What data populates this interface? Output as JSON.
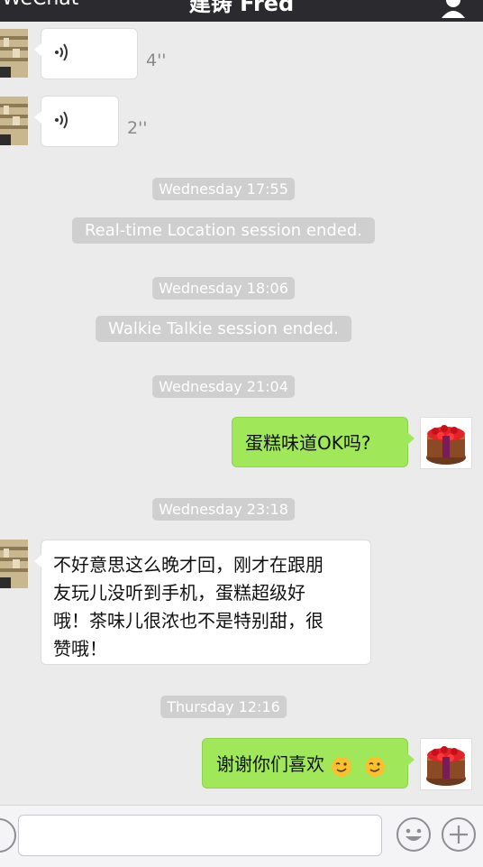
{
  "header": {
    "back_label": "WeChat",
    "title": "建铸 Fred"
  },
  "messages": [
    {
      "kind": "voice",
      "side": "left",
      "duration": "4''"
    },
    {
      "kind": "voice",
      "side": "left",
      "duration": "2''"
    },
    {
      "kind": "time",
      "text": "Wednesday 17:55"
    },
    {
      "kind": "system",
      "text": "Real-time Location session ended."
    },
    {
      "kind": "time",
      "text": "Wednesday 18:06"
    },
    {
      "kind": "system",
      "text": "Walkie Talkie session ended."
    },
    {
      "kind": "time",
      "text": "Wednesday 21:04"
    },
    {
      "kind": "text",
      "side": "right",
      "lines": [
        "蛋糕味道OK吗?"
      ]
    },
    {
      "kind": "time",
      "text": "Wednesday 23:18"
    },
    {
      "kind": "text",
      "side": "left",
      "lines": [
        "不好意思这么晚才回，刚才在跟朋",
        "友玩儿没听到手机，蛋糕超级好",
        "哦！茶味儿很浓也不是特别甜，很",
        "赞哦！"
      ]
    },
    {
      "kind": "time",
      "text": "Thursday 12:16"
    },
    {
      "kind": "text",
      "side": "right",
      "lines": [
        "谢谢你们喜欢"
      ],
      "emojis": [
        "wink-emoji",
        "wink-emoji"
      ]
    }
  ],
  "input": {
    "value": "",
    "placeholder": ""
  },
  "colors": {
    "sent_bubble": "#a0e75a",
    "received_bubble": "#ffffff",
    "timestamp_pill": "#cfcfcf",
    "background": "#ebebeb"
  }
}
